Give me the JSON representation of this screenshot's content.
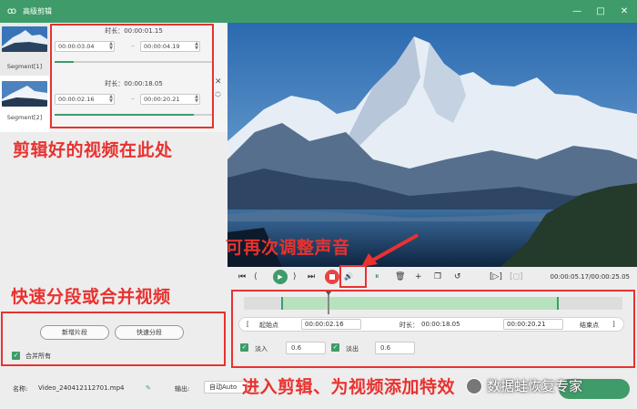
{
  "window": {
    "title": "高级剪辑"
  },
  "segments": [
    {
      "label": "Segment[1]",
      "duration_label": "时长：",
      "duration": "00:00:01.15",
      "start": "00:00:03.04",
      "end": "00:00:04.19"
    },
    {
      "label": "Segment[2]",
      "duration_label": "时长：",
      "duration": "00:00:18.05",
      "start": "00:00:02.16",
      "end": "00:00:20.21"
    }
  ],
  "player": {
    "timecode": "00:00:05.17/00:00:25.05"
  },
  "edit": {
    "start_btn": "起始点",
    "start_time": "00:00:02.16",
    "duration_label": "时长：",
    "duration": "00:00:18.05",
    "end_time": "00:00:20.21",
    "end_btn": "结束点",
    "fade_in_label": "淡入",
    "fade_in_value": "0.6",
    "fade_out_label": "淡出",
    "fade_out_value": "0.6"
  },
  "left_actions": {
    "new_segment": "新增片段",
    "quick_split": "快速分段",
    "merge_all": "合并所有"
  },
  "footer": {
    "name_label": "名称:",
    "file_name": "Video_240412112701.mp4",
    "output_label": "输出:",
    "output_value": "自动Auto"
  },
  "annotations": {
    "segments": "剪辑好的视频在此处",
    "volume": "可再次调整声音",
    "split_merge": "快速分段或合并视频",
    "effects": "进入剪辑、为视频添加特效"
  },
  "watermark": "数据蛙恢复专家",
  "colors": {
    "accent": "#3f9c6a",
    "annotation": "#e8322f",
    "stop": "#e64545"
  }
}
